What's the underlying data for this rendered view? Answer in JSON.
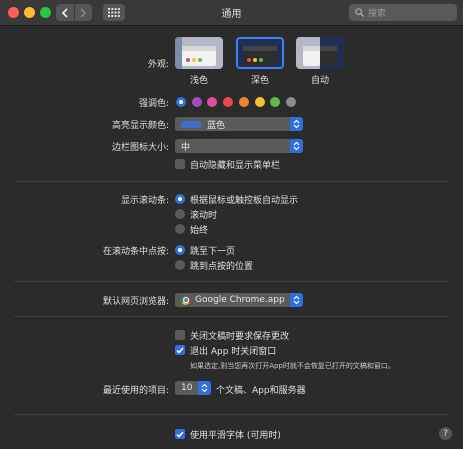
{
  "window": {
    "title": "通用"
  },
  "toolbar": {
    "search_placeholder": "搜索"
  },
  "appearance": {
    "label": "外观:",
    "options": [
      {
        "label": "浅色",
        "selected": false
      },
      {
        "label": "深色",
        "selected": true
      },
      {
        "label": "自动",
        "selected": false
      }
    ]
  },
  "accent": {
    "label": "强调色:",
    "colors": [
      "#2f6fe0",
      "#a24bc6",
      "#e14f9a",
      "#e8484f",
      "#f3842e",
      "#f5c22e",
      "#5dbb46",
      "#8c8c8c"
    ],
    "selected_index": 0
  },
  "highlight": {
    "label": "高亮显示颜色:",
    "value": "蓝色"
  },
  "sidebar_icon": {
    "label": "边栏图标大小:",
    "value": "中"
  },
  "menu_bar": {
    "label": "自动隐藏和显示菜单栏",
    "checked": false
  },
  "scroll_bars": {
    "label": "显示滚动条:",
    "options": [
      "根据鼠标或触控板自动显示",
      "滚动时",
      "始终"
    ],
    "selected_index": 0
  },
  "click_scroll": {
    "label": "在滚动条中点按:",
    "options": [
      "跳至下一页",
      "跳到点按的位置"
    ],
    "selected_index": 0
  },
  "browser": {
    "label": "默认网页浏览器:",
    "value": "Google Chrome.app"
  },
  "documents": {
    "ask_save": {
      "label": "关闭文稿时要求保存更改",
      "checked": false
    },
    "close_windows": {
      "label": "退出 App 时关闭窗口",
      "checked": true
    },
    "note": "如果选定,则当您再次打开App时就不会恢复已打开的文稿和窗口。"
  },
  "recent": {
    "label": "最近使用的项目:",
    "value": "10",
    "suffix": "个文稿、App和服务器"
  },
  "font_smoothing": {
    "label": "使用平滑字体 (可用时)",
    "checked": true
  },
  "help": {
    "label": "?"
  }
}
